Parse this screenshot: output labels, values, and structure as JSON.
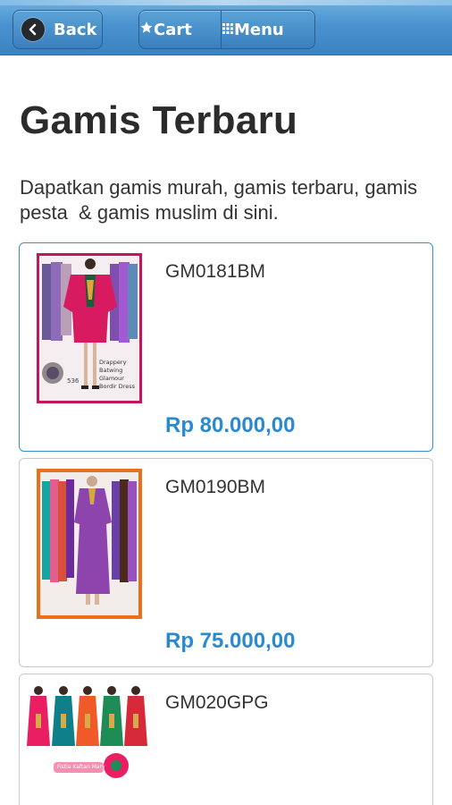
{
  "header": {
    "back_label": "Back",
    "cart_label": "Cart",
    "menu_label": "Menu"
  },
  "page": {
    "title": "Gamis Terbaru",
    "description": "Dapatkan gamis murah, gamis terbaru, gamis pesta  & gamis muslim di sini."
  },
  "products": [
    {
      "code": "GM0181BM",
      "price": "Rp 80.000,00",
      "image_caption_line1": "Drappery Batwing",
      "image_caption_line2": "Glamour Bordir Dress",
      "image_badge": "536"
    },
    {
      "code": "GM0190BM",
      "price": "Rp 75.000,00"
    },
    {
      "code": "GM020GPG",
      "price": "",
      "image_caption": "Fistia Kaftan Mary"
    }
  ],
  "colors": {
    "header_blue": "#4a93cf",
    "price_blue": "#2a8ad0",
    "active_border": "#3a8fd0",
    "frame_magenta": "#c2185b",
    "frame_orange": "#e8711e"
  },
  "icons": {
    "back": "chevron-left-circle-icon",
    "cart": "star-icon",
    "menu": "grid-icon"
  }
}
